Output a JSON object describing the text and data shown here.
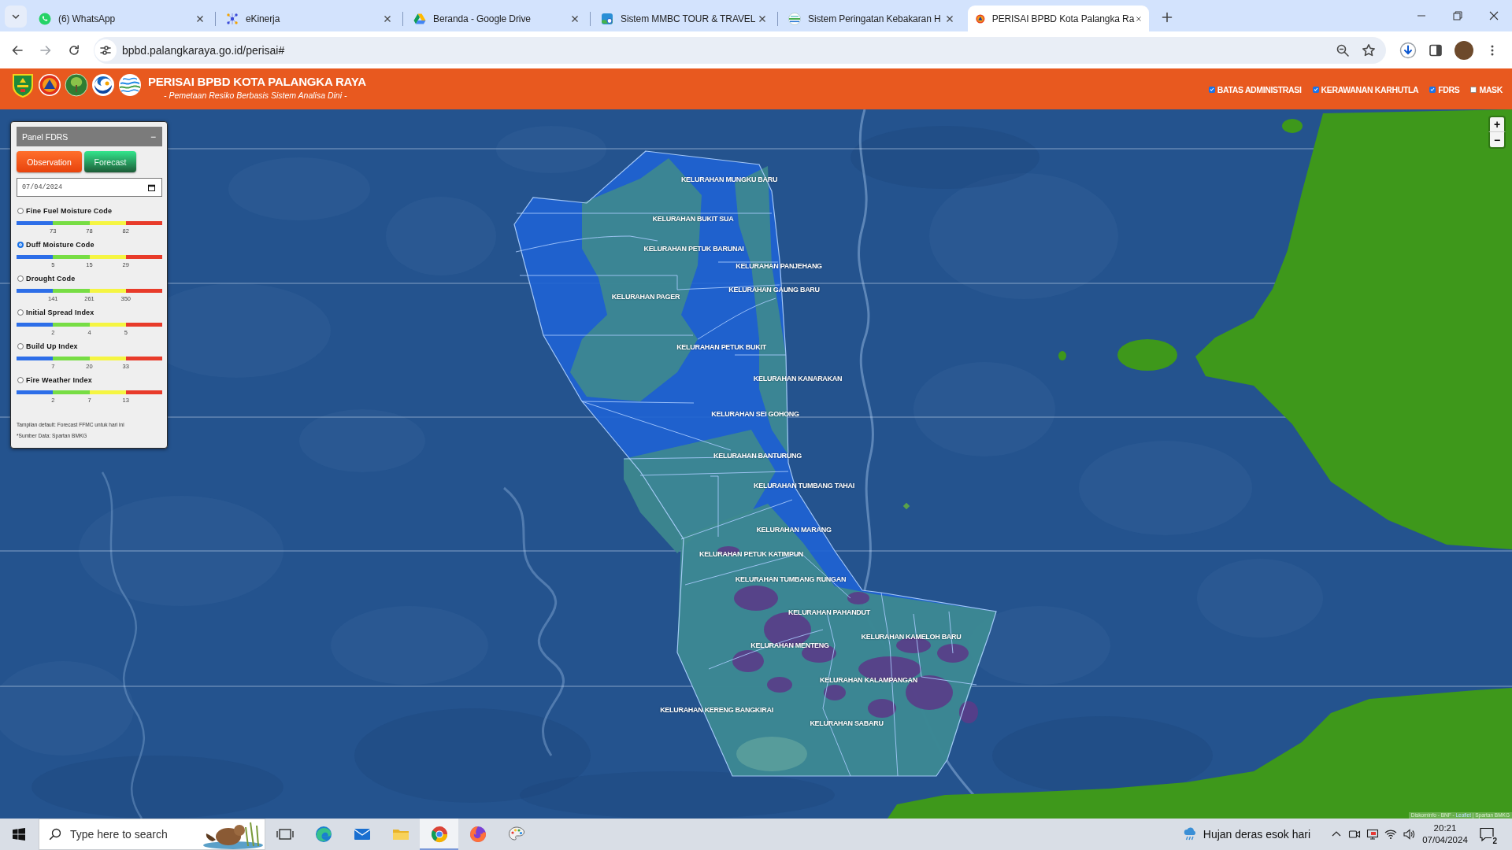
{
  "browser": {
    "tabs": [
      {
        "title": "(6) WhatsApp",
        "selected": false
      },
      {
        "title": "eKinerja",
        "selected": false
      },
      {
        "title": "Beranda - Google Drive",
        "selected": false
      },
      {
        "title": "Sistem MMBC TOUR & TRAVEL",
        "selected": false
      },
      {
        "title": "Sistem Peringatan Kebakaran H",
        "selected": false
      },
      {
        "title": "PERISAI BPBD Kota Palangka Ra",
        "selected": true
      }
    ],
    "address": "bpbd.palangkaraya.go.id/perisai#"
  },
  "header": {
    "title": "PERISAI BPBD KOTA PALANGKA RAYA",
    "subtitle": "- Pemetaan Resiko Berbasis Sistem Analisa Dini -",
    "layers": [
      {
        "label": "BATAS ADMINISTRASI",
        "checked": true
      },
      {
        "label": "KERAWANAN KARHUTLA",
        "checked": true
      },
      {
        "label": "FDRS",
        "checked": true
      },
      {
        "label": "MASK",
        "checked": false
      }
    ]
  },
  "panel": {
    "title": "Panel FDRS",
    "collapse": "−",
    "buttons": [
      {
        "label": "Observation",
        "kind": "observation"
      },
      {
        "label": "Forecast",
        "kind": "forecast"
      }
    ],
    "date": "07/04/2024",
    "indicators": [
      {
        "label": "Fine Fuel Moisture Code",
        "selected": false,
        "thresholds": [
          "73",
          "78",
          "82"
        ]
      },
      {
        "label": "Duff Moisture Code",
        "selected": true,
        "thresholds": [
          "5",
          "15",
          "29"
        ]
      },
      {
        "label": "Drought Code",
        "selected": false,
        "thresholds": [
          "141",
          "261",
          "350"
        ]
      },
      {
        "label": "Initial Spread Index",
        "selected": false,
        "thresholds": [
          "2",
          "4",
          "5"
        ]
      },
      {
        "label": "Build Up Index",
        "selected": false,
        "thresholds": [
          "7",
          "20",
          "33"
        ]
      },
      {
        "label": "Fire Weather Index",
        "selected": false,
        "thresholds": [
          "2",
          "7",
          "13"
        ]
      }
    ],
    "notes": [
      "Tampilan default: Forecast FFMC untuk hari ini",
      "*Sumber Data: Spartan BMKG"
    ]
  },
  "map": {
    "zoom_in": "+",
    "zoom_out": "−",
    "districts": [
      "KELURAHAN MUNGKU BARU",
      "KELURAHAN BUKIT SUA",
      "KELURAHAN PETUK BARUNAI",
      "KELURAHAN PANJEHANG",
      "KELURAHAN GAUNG BARU",
      "KELURAHAN PAGER",
      "KELURAHAN PETUK BUKIT",
      "KELURAHAN KANARAKAN",
      "KELURAHAN SEI GOHONG",
      "KELURAHAN BANTURUNG",
      "KELURAHAN TUMBANG TAHAI",
      "KELURAHAN MARANG",
      "KELURAHAN PETUK KATIMPUN",
      "KELURAHAN TUMBANG RUNGAN",
      "KELURAHAN PAHANDUT",
      "KELURAHAN KAMELOH BARU",
      "KELURAHAN MENTENG",
      "KELURAHAN KALAMPANGAN",
      "KELURAHAN KERENG BANGKIRAI",
      "KELURAHAN SABARU"
    ],
    "attribution": {
      "prefix": "Diskominfo - BNF - ",
      "link": "Leaflet",
      "suffix": " | Spartan BMKG"
    }
  },
  "taskbar": {
    "search_placeholder": "Type here to search",
    "apps": [
      {
        "kind": "task-view",
        "active": false
      },
      {
        "kind": "edge",
        "active": false
      },
      {
        "kind": "mail",
        "active": false
      },
      {
        "kind": "explorer",
        "active": false
      },
      {
        "kind": "chrome",
        "active": true
      },
      {
        "kind": "firefox",
        "active": false
      },
      {
        "kind": "paint",
        "active": false
      }
    ],
    "weather": "Hujan deras esok hari",
    "time": "20:21",
    "date": "07/04/2024",
    "notifications": "2"
  }
}
